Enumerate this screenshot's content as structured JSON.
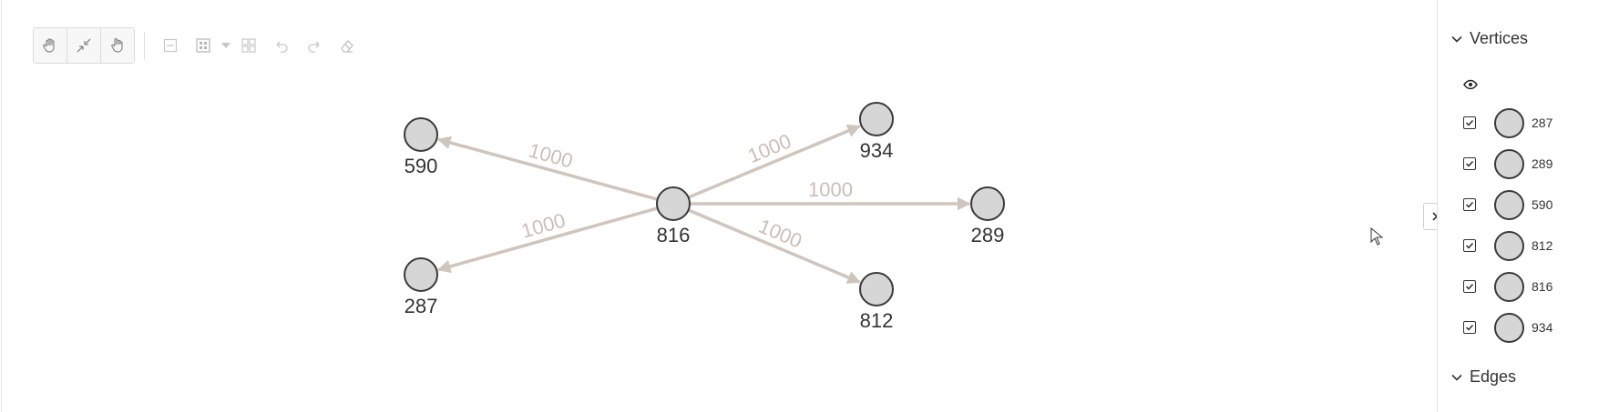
{
  "toolbar": {
    "buttons": [
      {
        "name": "pan-hand-icon"
      },
      {
        "name": "fit-view-icon"
      },
      {
        "name": "select-hand-icon"
      }
    ],
    "disabled_tools": [
      {
        "name": "collapse-icon"
      },
      {
        "name": "layout-grid-icon"
      },
      {
        "name": "group-icon"
      },
      {
        "name": "undo-icon"
      },
      {
        "name": "redo-icon"
      },
      {
        "name": "eraser-icon"
      }
    ]
  },
  "graph": {
    "nodes": [
      {
        "id": "590",
        "label": "590"
      },
      {
        "id": "934",
        "label": "934"
      },
      {
        "id": "816",
        "label": "816"
      },
      {
        "id": "289",
        "label": "289"
      },
      {
        "id": "287",
        "label": "287"
      },
      {
        "id": "812",
        "label": "812"
      }
    ],
    "edges": [
      {
        "from": "816",
        "to": "590",
        "label": "1000"
      },
      {
        "from": "816",
        "to": "934",
        "label": "1000"
      },
      {
        "from": "816",
        "to": "289",
        "label": "1000"
      },
      {
        "from": "816",
        "to": "287",
        "label": "1000"
      },
      {
        "from": "816",
        "to": "812",
        "label": "1000"
      }
    ],
    "colors": {
      "node_fill": "#d6d6d6",
      "node_stroke": "#3a3a3a",
      "edge": "#cfc5bd",
      "edge_label": "#c9bfb7"
    }
  },
  "panel": {
    "vertices_title": "Vertices",
    "edges_title": "Edges",
    "visibility_icon": "eye-icon",
    "vertices": [
      {
        "label": "287",
        "checked": true
      },
      {
        "label": "289",
        "checked": true
      },
      {
        "label": "590",
        "checked": true
      },
      {
        "label": "812",
        "checked": true
      },
      {
        "label": "816",
        "checked": true
      },
      {
        "label": "934",
        "checked": true
      }
    ]
  }
}
